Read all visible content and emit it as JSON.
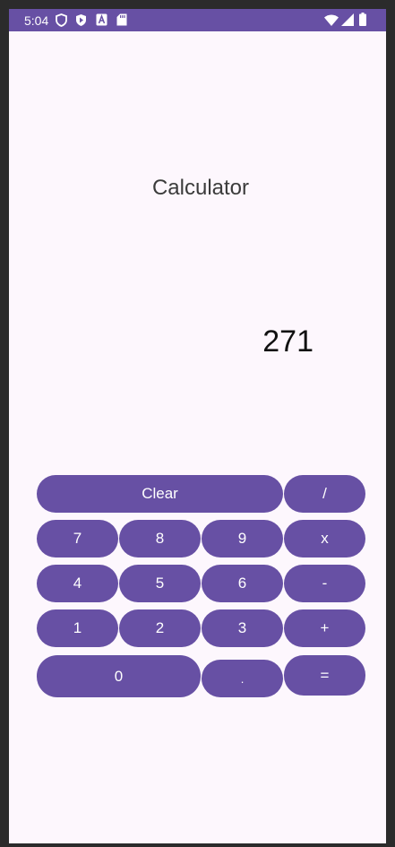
{
  "status_bar": {
    "time": "5:04",
    "left_icons": [
      "shield-icon",
      "play-protect-icon",
      "keyboard-a-icon",
      "sd-card-icon"
    ],
    "right_icons": [
      "wifi-icon",
      "signal-icon",
      "battery-icon"
    ],
    "color": "#6750a4"
  },
  "app": {
    "title": "Calculator",
    "display_value": "271",
    "accent_color": "#6750a4",
    "background_color": "#fdf7fd"
  },
  "keypad": {
    "clear": "Clear",
    "divide": "/",
    "seven": "7",
    "eight": "8",
    "nine": "9",
    "multiply": "x",
    "four": "4",
    "five": "5",
    "six": "6",
    "subtract": "-",
    "one": "1",
    "two": "2",
    "three": "3",
    "add": "+",
    "zero": "0",
    "decimal": ".",
    "equals": "="
  }
}
